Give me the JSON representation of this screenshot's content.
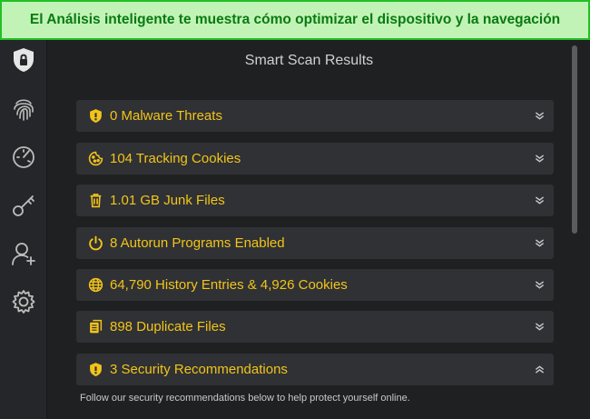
{
  "banner": {
    "text": "El Análisis inteligente te muestra cómo optimizar el dispositivo y la navegación"
  },
  "sidebar": {
    "items": [
      {
        "icon": "shield-lock-icon",
        "active": true
      },
      {
        "icon": "fingerprint-icon",
        "active": false
      },
      {
        "icon": "speedometer-icon",
        "active": false
      },
      {
        "icon": "key-icon",
        "active": false
      },
      {
        "icon": "add-user-icon",
        "active": false
      },
      {
        "icon": "gear-icon",
        "active": false
      }
    ]
  },
  "main": {
    "title": "Smart Scan Results",
    "results": [
      {
        "icon": "shield-icon",
        "label": "0 Malware Threats",
        "expanded": false
      },
      {
        "icon": "cookie-icon",
        "label": "104 Tracking Cookies",
        "expanded": false
      },
      {
        "icon": "trash-icon",
        "label": "1.01 GB Junk Files",
        "expanded": false
      },
      {
        "icon": "power-icon",
        "label": "8 Autorun Programs Enabled",
        "expanded": false
      },
      {
        "icon": "globe-icon",
        "label": "64,790 History Entries & 4,926 Cookies",
        "expanded": false
      },
      {
        "icon": "duplicate-files-icon",
        "label": "898 Duplicate Files",
        "expanded": false
      },
      {
        "icon": "shield-icon",
        "label": "3 Security Recommendations",
        "expanded": true
      }
    ],
    "footnote": "Follow our security recommendations below to help protect yourself online."
  },
  "colors": {
    "accent": "#f2c419",
    "banner_bg": "#c2f3b6",
    "banner_border": "#21c026",
    "banner_text": "#0a7a12",
    "row_bg": "#2f3134",
    "window_bg": "#1f2022"
  }
}
